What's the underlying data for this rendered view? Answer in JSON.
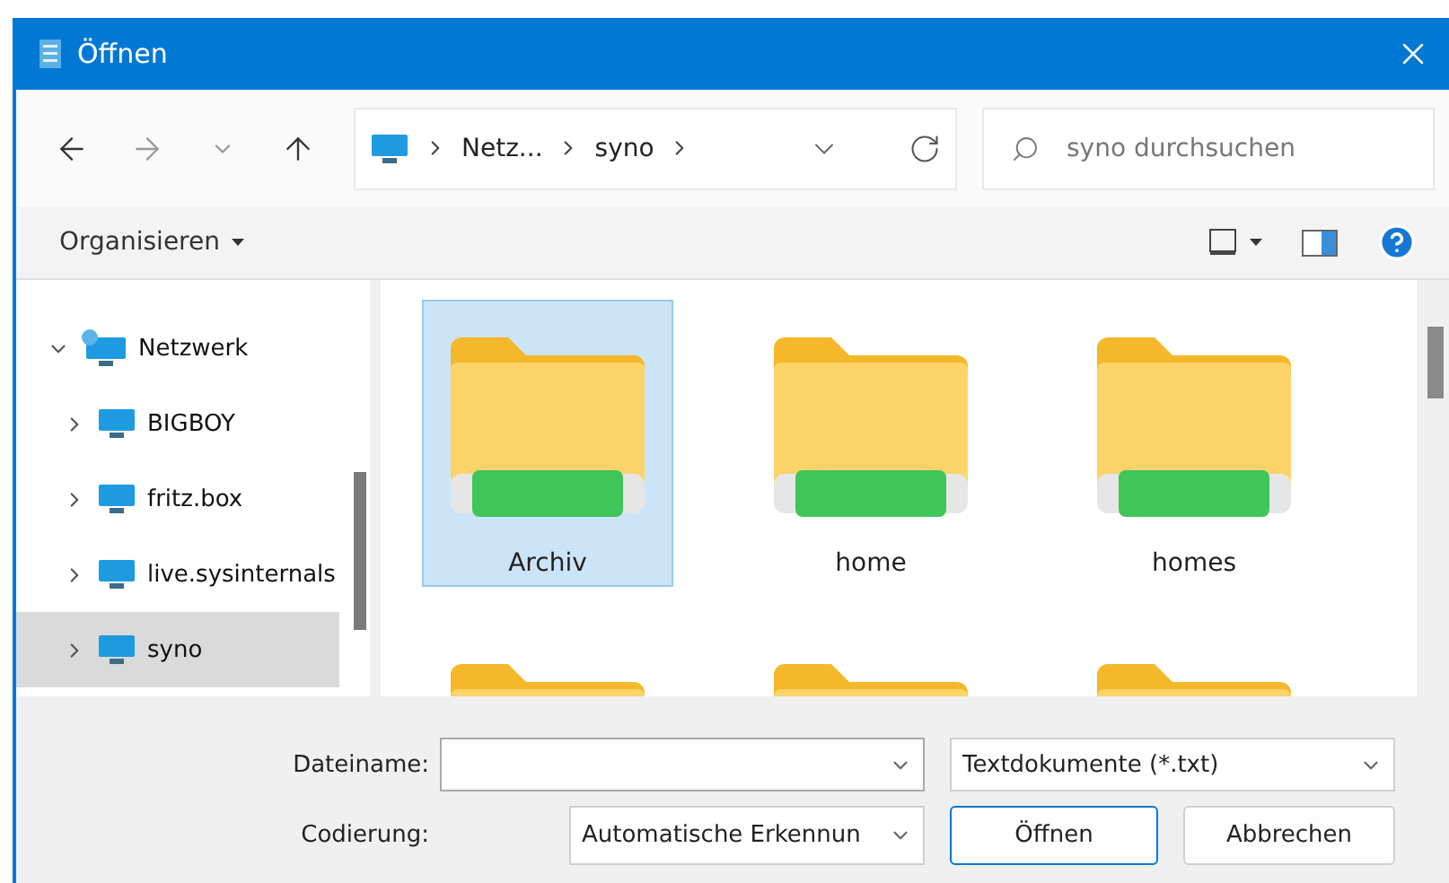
{
  "window": {
    "title": "Öffnen"
  },
  "address": {
    "crumbs": [
      "Netz...",
      "syno"
    ]
  },
  "search": {
    "placeholder": "syno durchsuchen"
  },
  "toolbar": {
    "organize": "Organisieren"
  },
  "sidebar": {
    "items": [
      {
        "label": "Netzwerk",
        "kind": "network",
        "expanded": true,
        "selected": false,
        "children": [
          {
            "label": "BIGBOY",
            "kind": "computer",
            "expanded": false,
            "selected": false
          },
          {
            "label": "fritz.box",
            "kind": "computer",
            "expanded": false,
            "selected": false
          },
          {
            "label": "live.sysinternals",
            "kind": "computer",
            "expanded": false,
            "selected": false
          },
          {
            "label": "syno",
            "kind": "computer",
            "expanded": false,
            "selected": true
          }
        ]
      }
    ]
  },
  "files": [
    {
      "label": "Archiv",
      "selected": true
    },
    {
      "label": "home",
      "selected": false
    },
    {
      "label": "homes",
      "selected": false
    },
    {
      "selected": false
    },
    {
      "selected": false
    },
    {
      "selected": false
    }
  ],
  "footer": {
    "filename_label": "Dateiname:",
    "filetype": "Textdokumente (*.txt)",
    "encoding_label": "Codierung:",
    "encoding": "Automatische Erkennun",
    "buttons": [
      "Öffnen",
      "Abbrechen"
    ]
  }
}
